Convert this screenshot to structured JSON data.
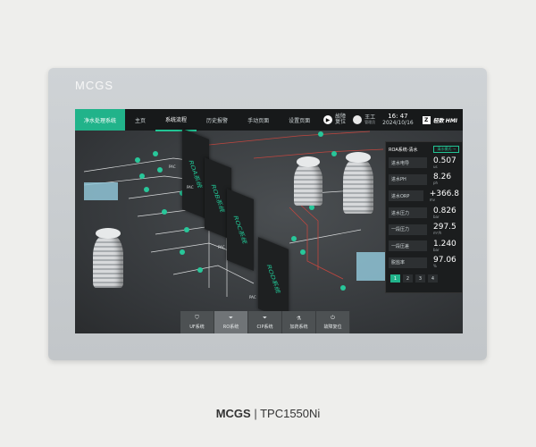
{
  "device": {
    "brand": "MCGS"
  },
  "topbar": {
    "system_name": "净水处理系统",
    "tabs": [
      "主页",
      "系统流程",
      "历史报警",
      "手动页面",
      "设置页面"
    ],
    "active_tab": "系统流程",
    "fault_reset": "故障\n复位",
    "user_name": "王工",
    "user_role": "管理员",
    "time": "16: 47",
    "date": "2024/10/16",
    "logo_text": "轻数 HMI"
  },
  "process": {
    "beam_labels": [
      "ROA系统",
      "ROB系统",
      "ROC系统",
      "ROD系统"
    ],
    "pac_label": "PAC"
  },
  "panel": {
    "title": "ROA系统-清水",
    "mode": "清水模式",
    "readings": [
      {
        "label": "进水电导",
        "value": "0.507",
        "unit": "us"
      },
      {
        "label": "进水PH",
        "value": "8.26",
        "unit": "ph"
      },
      {
        "label": "进水ORP",
        "value": "+366.8",
        "unit": "mv"
      },
      {
        "label": "进水压力",
        "value": "0.826",
        "unit": "bar"
      },
      {
        "label": "一段压力",
        "value": "297.5",
        "unit": "m³/h"
      },
      {
        "label": "一段压差",
        "value": "1.240",
        "unit": "bar"
      },
      {
        "label": "脱盐率",
        "value": "97.06",
        "unit": "%"
      }
    ],
    "pages": [
      "1",
      "2",
      "3",
      "4"
    ],
    "active_page": "1"
  },
  "bottom_nav": [
    {
      "label": "UF系统",
      "icon": "filter-icon"
    },
    {
      "label": "RO系统",
      "icon": "funnel-icon"
    },
    {
      "label": "CIP系统",
      "icon": "funnel-icon"
    },
    {
      "label": "加药系统",
      "icon": "flask-icon"
    },
    {
      "label": "故障复位",
      "icon": "power-icon"
    }
  ],
  "active_bottom": "RO系统",
  "caption": {
    "brand": "MCGS",
    "model": "TPC1550Ni"
  }
}
